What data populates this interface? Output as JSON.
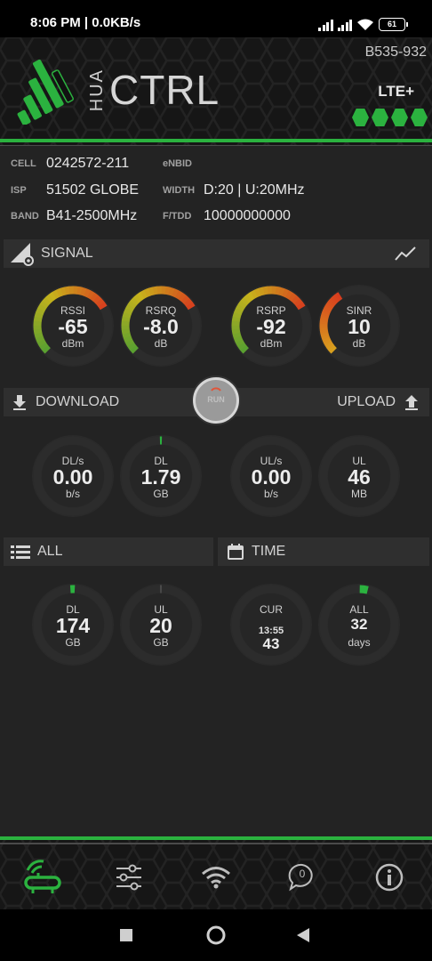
{
  "status_bar": {
    "time": "8:06 PM | 0.0KB/s",
    "battery": "61"
  },
  "header": {
    "app_title_small": "HUA",
    "app_title_large": "CTRL",
    "device_model": "B535-932",
    "network_type": "LTE+",
    "accent_color": "#2bb23f"
  },
  "info": {
    "cell_label": "CELL",
    "cell_value": "0242572-211",
    "enbid_label": "eNBID",
    "enbid_value": "",
    "isp_label": "ISP",
    "isp_value": "51502 GLOBE",
    "width_label": "WIDTH",
    "width_value": "D:20 | U:20MHz",
    "band_label": "BAND",
    "band_value": "B41-2500MHz",
    "ftdd_label": "F/TDD",
    "ftdd_value": "10000000000"
  },
  "signal_section": {
    "label": "SIGNAL"
  },
  "signal_gauges": [
    {
      "title": "RSSI",
      "value": "-65",
      "unit": "dBm",
      "level": 0.72
    },
    {
      "title": "RSRQ",
      "value": "-8.0",
      "unit": "dB",
      "level": 0.72
    },
    {
      "title": "RSRP",
      "value": "-92",
      "unit": "dBm",
      "level": 0.72
    },
    {
      "title": "SINR",
      "value": "10",
      "unit": "dB",
      "level": 0.38
    }
  ],
  "transfer_section": {
    "download_label": "DOWNLOAD",
    "upload_label": "UPLOAD",
    "run_label": "RUN"
  },
  "transfer_gauges": [
    {
      "title": "DL/s",
      "value": "0.00",
      "unit": "b/s"
    },
    {
      "title": "DL",
      "value": "1.79",
      "unit": "GB"
    },
    {
      "title": "UL/s",
      "value": "0.00",
      "unit": "b/s"
    },
    {
      "title": "UL",
      "value": "46",
      "unit": "MB"
    }
  ],
  "totals_section": {
    "all_label": "ALL",
    "time_label": "TIME"
  },
  "totals_gauges": [
    {
      "title": "DL",
      "value": "174",
      "unit": "GB"
    },
    {
      "title": "UL",
      "value": "20",
      "unit": "GB"
    },
    {
      "title": "CUR",
      "time": "13:55",
      "value": "43"
    },
    {
      "title": "ALL",
      "value": "32",
      "unit": "days"
    }
  ],
  "bottom_nav": {
    "messages_count": "0"
  },
  "gauge_colors": {
    "track": "#2c2c2c",
    "ring_bg": "#303030",
    "green": "#2bb23f",
    "red": "#d83a1e",
    "yellow": "#c8b21c"
  }
}
